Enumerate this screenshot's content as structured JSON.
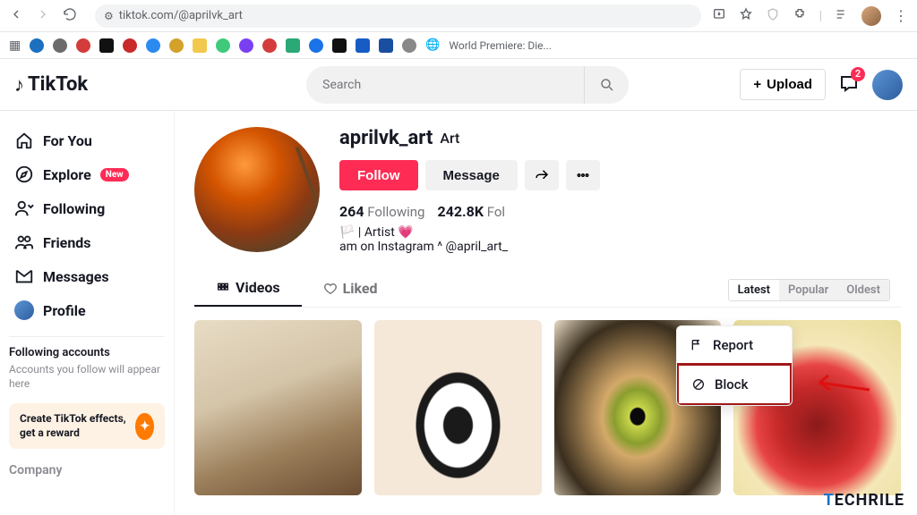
{
  "browser": {
    "url": "tiktok.com/@aprilvk_art",
    "bookmark_last": "World Premiere: Die..."
  },
  "header": {
    "logo": "TikTok",
    "search_placeholder": "Search",
    "upload_label": "Upload",
    "msg_badge": "2"
  },
  "sidebar": {
    "items": [
      {
        "label": "For You"
      },
      {
        "label": "Explore",
        "pill": "New"
      },
      {
        "label": "Following"
      },
      {
        "label": "Friends"
      },
      {
        "label": "Messages"
      },
      {
        "label": "Profile"
      }
    ],
    "following_title": "Following accounts",
    "following_text": "Accounts you follow will appear here",
    "effects_title": "Create TikTok effects, get a reward",
    "company": "Company"
  },
  "profile": {
    "username": "aprilvk_art",
    "displayname": "Art",
    "follow_label": "Follow",
    "message_label": "Message",
    "following_count": "264",
    "following_label": "Following",
    "followers_count": "242.8K",
    "followers_label_truncated": "Fol",
    "bio_line1_flag": "🏳️",
    "bio_line1": "| Artist 💗",
    "bio_line2": "am on Instagram ^ @april_art_",
    "tabs": {
      "videos": "Videos",
      "liked": "Liked"
    },
    "sort": {
      "latest": "Latest",
      "popular": "Popular",
      "oldest": "Oldest"
    }
  },
  "dropdown": {
    "report": "Report",
    "block": "Block"
  },
  "watermark": {
    "t1": "T",
    "t2": "ECHRILE"
  }
}
